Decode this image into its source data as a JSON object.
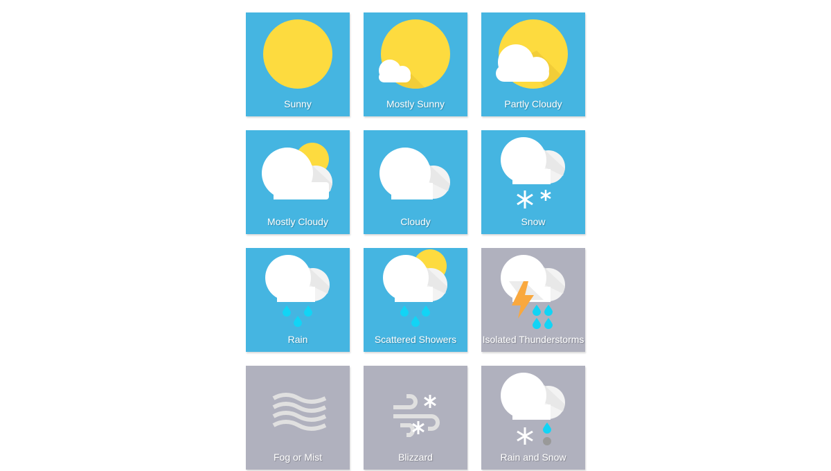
{
  "colors": {
    "sky_blue": "#45b5e1",
    "storm_gray": "#b0b1be",
    "sun_yellow": "#fddb3f",
    "cloud_white": "#ffffff",
    "rain_cyan": "#12d4f5",
    "lightning_orange": "#f9a83e",
    "fog_gray": "#e0e0e0",
    "sleet_gray": "#999999"
  },
  "tiles": [
    {
      "id": "sunny",
      "label": "Sunny",
      "background": "blue"
    },
    {
      "id": "mostly-sunny",
      "label": "Mostly Sunny",
      "background": "blue"
    },
    {
      "id": "partly-cloudy",
      "label": "Partly Cloudy",
      "background": "blue"
    },
    {
      "id": "mostly-cloudy",
      "label": "Mostly Cloudy",
      "background": "blue"
    },
    {
      "id": "cloudy",
      "label": "Cloudy",
      "background": "blue"
    },
    {
      "id": "snow",
      "label": "Snow",
      "background": "blue"
    },
    {
      "id": "rain",
      "label": "Rain",
      "background": "blue"
    },
    {
      "id": "scattered-showers",
      "label": "Scattered Showers",
      "background": "blue"
    },
    {
      "id": "isolated-thunderstorms",
      "label": "Isolated Thunderstorms",
      "background": "gray"
    },
    {
      "id": "fog-or-mist",
      "label": "Fog or Mist",
      "background": "gray"
    },
    {
      "id": "blizzard",
      "label": "Blizzard",
      "background": "gray"
    },
    {
      "id": "rain-and-snow",
      "label": "Rain and Snow",
      "background": "gray"
    }
  ]
}
